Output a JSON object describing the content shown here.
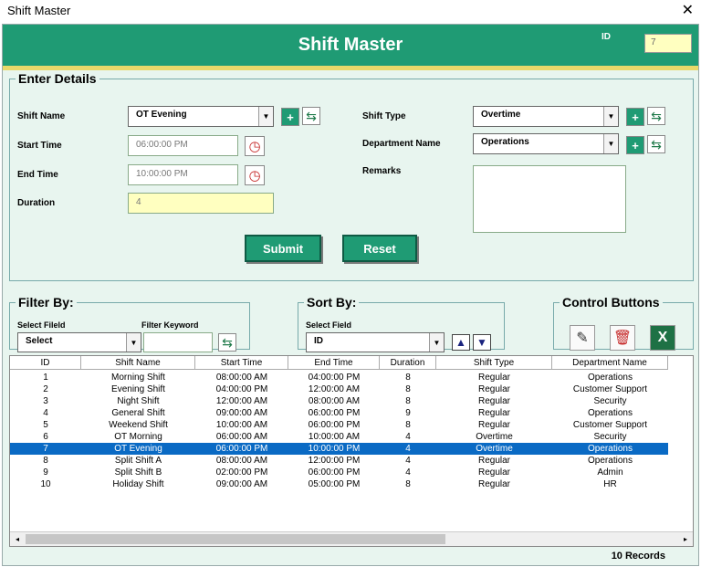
{
  "window": {
    "title": "Shift Master",
    "close_glyph": "✕"
  },
  "header": {
    "title": "Shift Master",
    "id_label": "ID",
    "id_value": "7"
  },
  "details": {
    "legend": "Enter Details",
    "shift_name_label": "Shift Name",
    "shift_name_value": "OT Evening",
    "start_time_label": "Start Time",
    "start_time_value": "06:00:00 PM",
    "end_time_label": "End Time",
    "end_time_value": "10:00:00 PM",
    "duration_label": "Duration",
    "duration_value": "4",
    "shift_type_label": "Shift Type",
    "shift_type_value": "Overtime",
    "department_label": "Department Name",
    "department_value": "Operations",
    "remarks_label": "Remarks",
    "remarks_value": "",
    "submit_label": "Submit",
    "reset_label": "Reset"
  },
  "filter": {
    "legend": "Filter By:",
    "field_label": "Select Fileld",
    "field_value": "Select",
    "keyword_label": "Filter Keyword",
    "keyword_value": ""
  },
  "sort": {
    "legend": "Sort By:",
    "field_label": "Select Field",
    "field_value": "ID"
  },
  "control": {
    "legend": "Control Buttons"
  },
  "icons": {
    "add": "+",
    "sync": "⇆",
    "clock": "◷",
    "dropdown": "▼",
    "up": "▲",
    "down": "▼",
    "edit": "✎",
    "delete": "🗑",
    "excel": "X",
    "left": "◂",
    "right": "▸"
  },
  "colors": {
    "accent": "#1F9B74",
    "stripe": "#E8D86A",
    "panel": "#E8F5EF",
    "selected_row": "#0A6AC4"
  },
  "table": {
    "columns": [
      "ID",
      "Shift Name",
      "Start Time",
      "End Time",
      "Duration",
      "Shift Type",
      "Department Name"
    ],
    "rows": [
      [
        "1",
        "Morning Shift",
        "08:00:00 AM",
        "04:00:00 PM",
        "8",
        "Regular",
        "Operations"
      ],
      [
        "2",
        "Evening Shift",
        "04:00:00 PM",
        "12:00:00 AM",
        "8",
        "Regular",
        "Customer Support"
      ],
      [
        "3",
        "Night Shift",
        "12:00:00 AM",
        "08:00:00 AM",
        "8",
        "Regular",
        "Security"
      ],
      [
        "4",
        "General Shift",
        "09:00:00 AM",
        "06:00:00 PM",
        "9",
        "Regular",
        "Operations"
      ],
      [
        "5",
        "Weekend Shift",
        "10:00:00 AM",
        "06:00:00 PM",
        "8",
        "Regular",
        "Customer Support"
      ],
      [
        "6",
        "OT Morning",
        "06:00:00 AM",
        "10:00:00 AM",
        "4",
        "Overtime",
        "Security"
      ],
      [
        "7",
        "OT Evening",
        "06:00:00 PM",
        "10:00:00 PM",
        "4",
        "Overtime",
        "Operations"
      ],
      [
        "8",
        "Split Shift A",
        "08:00:00 AM",
        "12:00:00 PM",
        "4",
        "Regular",
        "Operations"
      ],
      [
        "9",
        "Split Shift B",
        "02:00:00 PM",
        "06:00:00 PM",
        "4",
        "Regular",
        "Admin"
      ],
      [
        "10",
        "Holiday Shift",
        "09:00:00 AM",
        "05:00:00 PM",
        "8",
        "Regular",
        "HR"
      ]
    ],
    "selected_row_id": "7",
    "record_count": "10 Records"
  }
}
